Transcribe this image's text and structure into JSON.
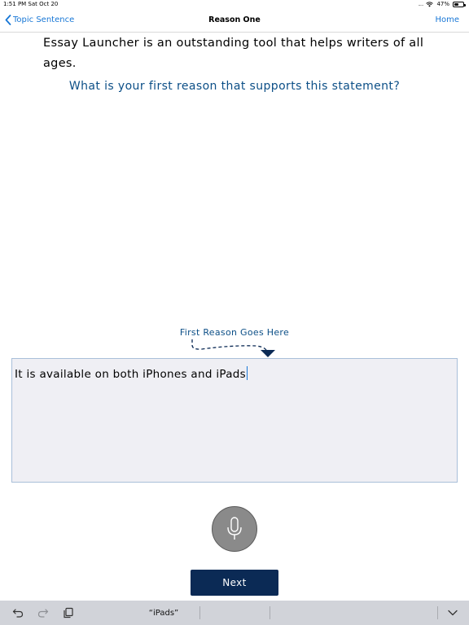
{
  "status_bar": {
    "time_date": "1:51 PM  Sat Oct 20",
    "signal": ".....",
    "battery": "47%",
    "battery_level": 0.47
  },
  "nav": {
    "back_label": "Topic Sentence",
    "title": "Reason One",
    "home_label": "Home"
  },
  "content": {
    "statement": "Essay Launcher is an outstanding tool that helps writers of all ages.",
    "prompt": "What is your first reason that supports this statement?",
    "reason_label": "First Reason Goes Here",
    "answer_value": "It is available on both iPhones and iPads"
  },
  "buttons": {
    "next_label": "Next"
  },
  "keyboard": {
    "suggestions": [
      "“iPads”",
      "",
      ""
    ]
  },
  "colors": {
    "accent": "#1877d6",
    "prompt_text": "#0c4f87",
    "next_button": "#0b2a55",
    "field_background": "#efeff4"
  }
}
